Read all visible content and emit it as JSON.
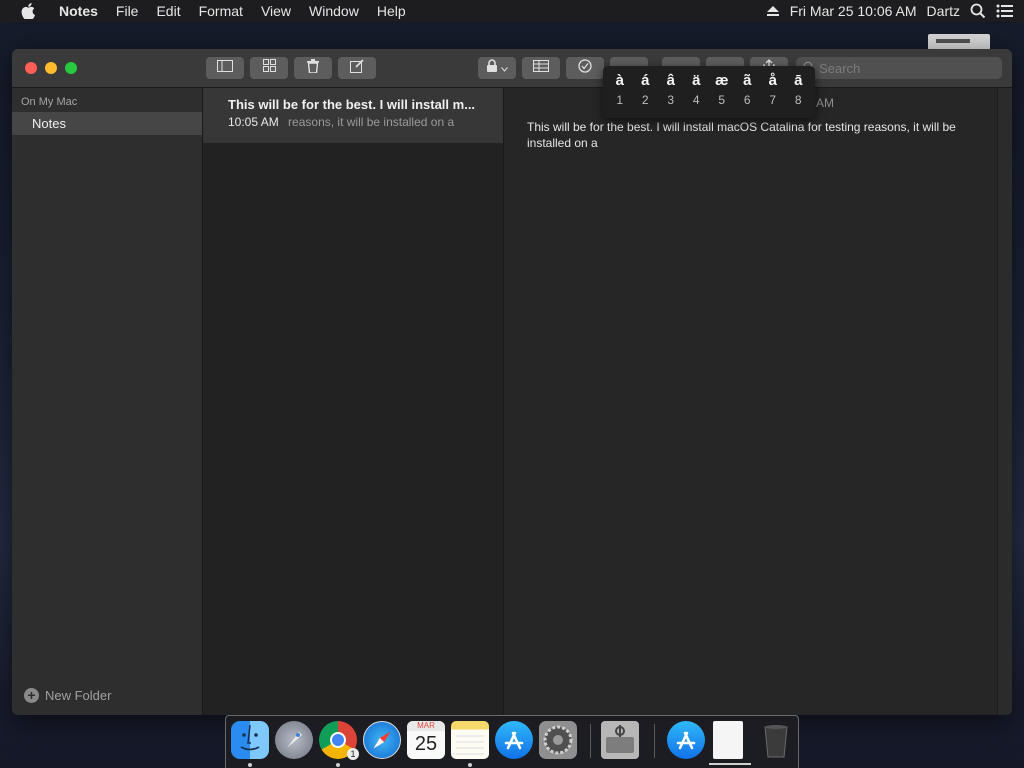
{
  "menubar": {
    "app_name": "Notes",
    "menus": [
      "File",
      "Edit",
      "Format",
      "View",
      "Window",
      "Help"
    ],
    "datetime": "Fri Mar 25  10:06 AM",
    "user": "Dartz"
  },
  "sidebar": {
    "section_title": "On My Mac",
    "folder": "Notes",
    "new_folder": "New Folder"
  },
  "search": {
    "placeholder": "Search"
  },
  "note_list": {
    "title": "This will be for the best. I will install m...",
    "time": "10:05 AM",
    "preview": "reasons, it will be installed on a"
  },
  "editor": {
    "date_fragment": "AM",
    "body": "This will be for the best. I will install macOS Catalina for testing reasons, it will be installed on a"
  },
  "accent_popup": [
    {
      "char": "à",
      "num": "1"
    },
    {
      "char": "á",
      "num": "2"
    },
    {
      "char": "â",
      "num": "3"
    },
    {
      "char": "ä",
      "num": "4"
    },
    {
      "char": "æ",
      "num": "5"
    },
    {
      "char": "ã",
      "num": "6"
    },
    {
      "char": "å",
      "num": "7"
    },
    {
      "char": "ā",
      "num": "8"
    }
  ],
  "dock": {
    "calendar_month": "MAR",
    "calendar_day": "25",
    "chrome_badge": "1"
  },
  "colors": {
    "close": "#ff5f57",
    "minimize": "#febc2e",
    "zoom": "#28c840"
  }
}
